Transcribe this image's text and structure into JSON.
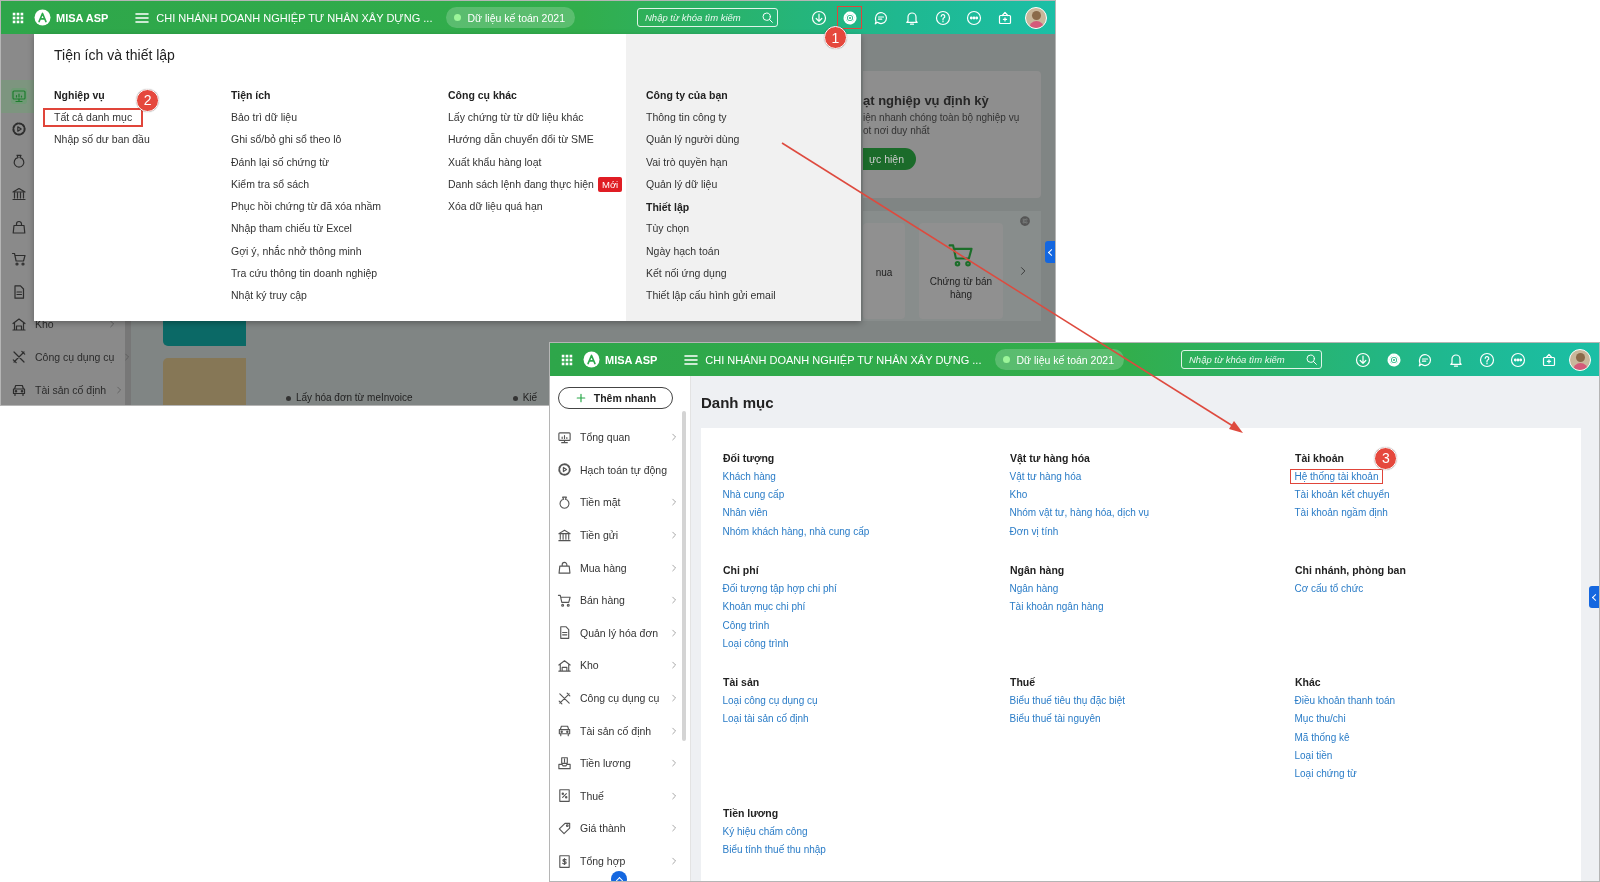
{
  "background_screen": {
    "topbar": {
      "app_name": "MISA ASP",
      "company": "CHI NHÁNH DOANH NGHIỆP TƯ NHÂN XÂY DỰNG ...",
      "data_badge": "Dữ liệu kế toán 2021",
      "search": {
        "placeholder": "Nhập từ khóa tìm kiếm"
      },
      "actions": [
        {
          "kind": "download",
          "highlighted": false
        },
        {
          "kind": "settings",
          "highlighted": true,
          "callout": "1"
        },
        {
          "kind": "chat",
          "highlighted": false
        },
        {
          "kind": "bell",
          "highlighted": false
        },
        {
          "kind": "help",
          "highlighted": false
        },
        {
          "kind": "more",
          "highlighted": false
        },
        {
          "kind": "announce",
          "highlighted": false
        },
        {
          "kind": "avatar",
          "highlighted": false
        }
      ]
    },
    "sidebar": {
      "items": [
        {
          "kind": "monitor",
          "selected": true
        },
        {
          "kind": "gear_play",
          "selected": false
        },
        {
          "kind": "money_bag",
          "selected": false
        },
        {
          "kind": "bank",
          "selected": false
        },
        {
          "kind": "bag",
          "selected": false
        },
        {
          "kind": "cart",
          "selected": false
        },
        {
          "kind": "document",
          "selected": false
        },
        {
          "kind": "warehouse",
          "label": "Kho",
          "selected": false
        },
        {
          "kind": "tools",
          "label": "Công cụ dụng cụ",
          "selected": false
        },
        {
          "kind": "car",
          "label": "Tài sản cố định",
          "selected": false
        }
      ]
    },
    "promo_card": {
      "title": "ạt nghiệp vụ định kỳ",
      "lines": [
        "iện nhanh chóng toàn bộ nghiệp vụ",
        "ot nơi duy nhất"
      ],
      "button": "ực hiện"
    },
    "shortcut_tiles": [
      {
        "label": "nua"
      },
      {
        "label": "Chứng từ bán hàng",
        "kind": "cart"
      }
    ],
    "news": [
      "Lấy hóa đơn từ meInvoice",
      "Kiế"
    ],
    "menu": {
      "title": "Tiện ích và thiết lập",
      "columns": [
        {
          "shaded": false,
          "groups": [
            {
              "heading": "Nghiệp vụ",
              "items": [
                {
                  "label": "Tất cả danh mục",
                  "highlighted": true,
                  "callout": "2"
                },
                {
                  "label": "Nhập số dư ban đầu",
                  "highlighted": false
                }
              ]
            }
          ]
        },
        {
          "shaded": false,
          "groups": [
            {
              "heading": "Tiện ích",
              "items": [
                {
                  "label": "Bảo trì dữ liệu",
                  "highlighted": false
                },
                {
                  "label": "Ghi sổ/bỏ ghi sổ theo lô",
                  "highlighted": false
                },
                {
                  "label": "Đánh lại số chứng từ",
                  "highlighted": false
                },
                {
                  "label": "Kiểm tra sổ sách",
                  "highlighted": false
                },
                {
                  "label": "Phục hồi chứng từ đã xóa nhầm",
                  "highlighted": false
                },
                {
                  "label": "Nhập tham chiếu từ Excel",
                  "highlighted": false
                },
                {
                  "label": "Gợi ý, nhắc nhở thông minh",
                  "highlighted": false
                },
                {
                  "label": "Tra cứu thông tin doanh nghiệp",
                  "highlighted": false
                },
                {
                  "label": "Nhật ký truy cập",
                  "highlighted": false
                }
              ]
            }
          ]
        },
        {
          "shaded": false,
          "groups": [
            {
              "heading": "Công cụ khác",
              "items": [
                {
                  "label": "Lấy chứng từ từ dữ liệu khác",
                  "highlighted": false
                },
                {
                  "label": "Hướng dẫn chuyển đổi từ SME",
                  "highlighted": false
                },
                {
                  "label": "Xuất khẩu hàng loạt",
                  "highlighted": false
                },
                {
                  "label": "Danh sách lệnh đang thực hiện",
                  "badge": "Mới",
                  "highlighted": false
                },
                {
                  "label": "Xóa dữ liệu quá hạn",
                  "highlighted": false
                }
              ]
            }
          ]
        },
        {
          "shaded": true,
          "groups": [
            {
              "heading": "Công ty của bạn",
              "items": [
                {
                  "label": "Thông tin công ty",
                  "highlighted": false
                },
                {
                  "label": "Quản lý người dùng",
                  "highlighted": false
                },
                {
                  "label": "Vai trò quyền hạn",
                  "highlighted": false
                },
                {
                  "label": "Quản lý dữ liệu",
                  "highlighted": false
                }
              ]
            },
            {
              "heading": "Thiết lập",
              "items": [
                {
                  "label": "Tùy chọn",
                  "highlighted": false
                },
                {
                  "label": "Ngày hạch toán",
                  "highlighted": false
                },
                {
                  "label": "Kết nối ứng dụng",
                  "highlighted": false
                },
                {
                  "label": "Thiết lập cấu hình gửi email",
                  "highlighted": false
                }
              ]
            }
          ]
        }
      ]
    }
  },
  "foreground_screen": {
    "topbar": {
      "app_name": "MISA ASP",
      "company": "CHI NHÁNH DOANH NGHIỆP TƯ NHÂN XÂY DỰNG ...",
      "data_badge": "Dữ liệu kế toán 2021",
      "search": {
        "placeholder": "Nhập từ khóa tìm kiếm"
      },
      "actions": [
        {
          "kind": "download",
          "highlighted": false
        },
        {
          "kind": "settings",
          "highlighted": false
        },
        {
          "kind": "chat",
          "highlighted": false
        },
        {
          "kind": "bell",
          "highlighted": false
        },
        {
          "kind": "help",
          "highlighted": false
        },
        {
          "kind": "more",
          "highlighted": false
        },
        {
          "kind": "announce",
          "highlighted": false
        },
        {
          "kind": "avatar",
          "highlighted": false
        }
      ]
    },
    "sidebar": {
      "quick_add": "Thêm nhanh",
      "items": [
        {
          "kind": "monitor",
          "label": "Tổng quan",
          "has_children": true
        },
        {
          "kind": "gear_play",
          "label": "Hạch toán tự động",
          "has_children": false
        },
        {
          "kind": "money_bag",
          "label": "Tiền mặt",
          "has_children": true
        },
        {
          "kind": "bank",
          "label": "Tiền gửi",
          "has_children": true
        },
        {
          "kind": "bag",
          "label": "Mua hàng",
          "has_children": true
        },
        {
          "kind": "cart",
          "label": "Bán hàng",
          "has_children": true
        },
        {
          "kind": "document",
          "label": "Quản lý hóa đơn",
          "has_children": true
        },
        {
          "kind": "warehouse",
          "label": "Kho",
          "has_children": true
        },
        {
          "kind": "tools",
          "label": "Công cụ dụng cụ",
          "has_children": true
        },
        {
          "kind": "car",
          "label": "Tài sản cố định",
          "has_children": true
        },
        {
          "kind": "salary",
          "label": "Tiền lương",
          "has_children": true
        },
        {
          "kind": "tax",
          "label": "Thuế",
          "has_children": true
        },
        {
          "kind": "tag",
          "label": "Giá thành",
          "has_children": true
        },
        {
          "kind": "summary",
          "label": "Tổng hợp",
          "has_children": true
        }
      ]
    },
    "page_title": "Danh mục",
    "groups": [
      {
        "heading": "Đối tượng",
        "items": [
          {
            "label": "Khách hàng",
            "highlighted": false
          },
          {
            "label": "Nhà cung cấp",
            "highlighted": false
          },
          {
            "label": "Nhân viên",
            "highlighted": false
          },
          {
            "label": "Nhóm khách hàng, nhà cung cấp",
            "highlighted": false
          }
        ]
      },
      {
        "heading": "Vật tư hàng hóa",
        "items": [
          {
            "label": "Vật tư hàng hóa",
            "highlighted": false
          },
          {
            "label": "Kho",
            "highlighted": false
          },
          {
            "label": "Nhóm vật tư, hàng hóa, dịch vụ",
            "highlighted": false
          },
          {
            "label": "Đơn vị tính",
            "highlighted": false
          }
        ]
      },
      {
        "heading": "Tài khoản",
        "items": [
          {
            "label": "Hệ thống tài khoản",
            "highlighted": true,
            "callout": "3"
          },
          {
            "label": "Tài khoản kết chuyển",
            "highlighted": false
          },
          {
            "label": "Tài khoản ngầm định",
            "highlighted": false
          }
        ]
      },
      {
        "heading": "Chi phí",
        "items": [
          {
            "label": "Đối tượng tập hợp chi phí",
            "highlighted": false
          },
          {
            "label": "Khoản mục chi phí",
            "highlighted": false
          },
          {
            "label": "Công trình",
            "highlighted": false
          },
          {
            "label": "Loại công trình",
            "highlighted": false
          }
        ]
      },
      {
        "heading": "Ngân hàng",
        "items": [
          {
            "label": "Ngân hàng",
            "highlighted": false
          },
          {
            "label": "Tài khoản ngân hàng",
            "highlighted": false
          }
        ]
      },
      {
        "heading": "Chi nhánh, phòng ban",
        "items": [
          {
            "label": "Cơ cấu tổ chức",
            "highlighted": false
          }
        ]
      },
      {
        "heading": "Tài sản",
        "items": [
          {
            "label": "Loại công cụ dụng cụ",
            "highlighted": false
          },
          {
            "label": "Loại tài sản cố định",
            "highlighted": false
          }
        ]
      },
      {
        "heading": "Thuế",
        "items": [
          {
            "label": "Biểu thuế tiêu thụ đặc biệt",
            "highlighted": false
          },
          {
            "label": "Biểu thuế tài nguyên",
            "highlighted": false
          }
        ]
      },
      {
        "heading": "Khác",
        "items": [
          {
            "label": "Điều khoản thanh toán",
            "highlighted": false
          },
          {
            "label": "Mục thu/chi",
            "highlighted": false
          },
          {
            "label": "Mã thống kê",
            "highlighted": false
          },
          {
            "label": "Loại tiền",
            "highlighted": false
          },
          {
            "label": "Loại chứng từ",
            "highlighted": false
          }
        ]
      },
      {
        "heading": "Tiền lương",
        "items": [
          {
            "label": "Ký hiệu chấm công",
            "highlighted": false
          },
          {
            "label": "Biểu tính thuế thu nhập",
            "highlighted": false
          }
        ]
      }
    ]
  }
}
